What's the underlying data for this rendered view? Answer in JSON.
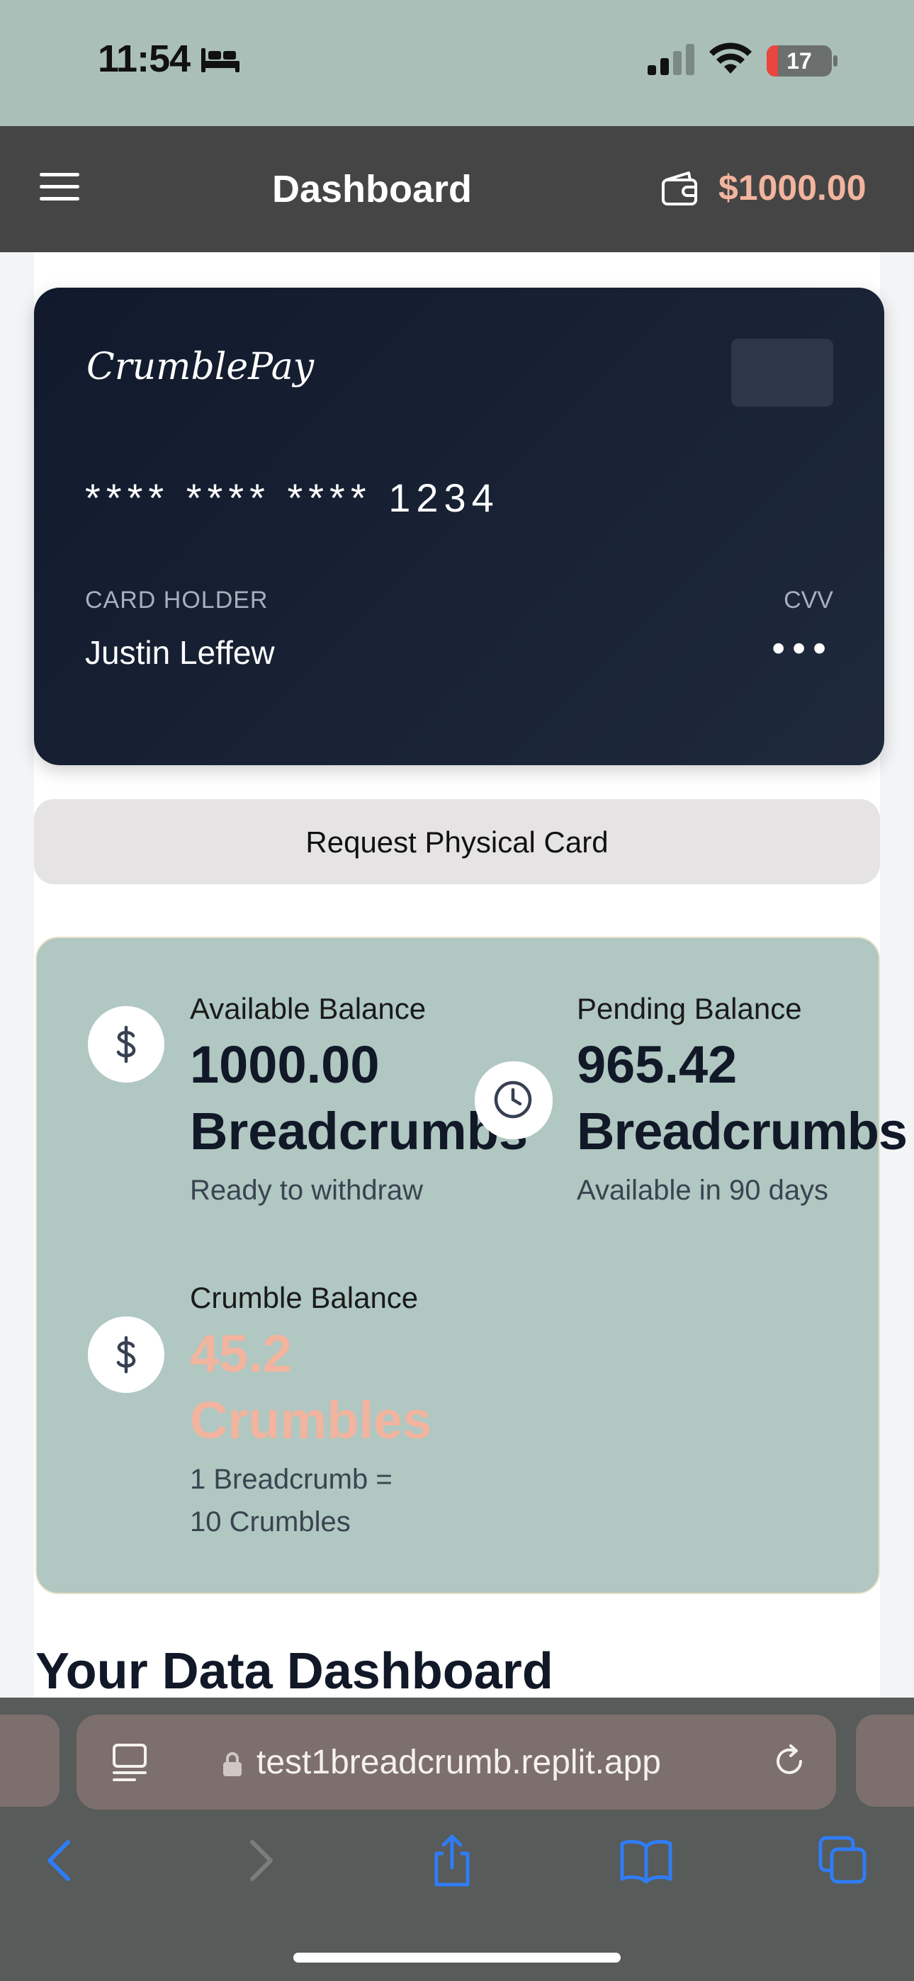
{
  "status_bar": {
    "time": "11:54",
    "battery": "17",
    "battery_level": 0.17
  },
  "header": {
    "title": "Dashboard",
    "wallet_amount": "$1000.00"
  },
  "card": {
    "brand": "CrumblePay",
    "number": "**** **** **** 1234",
    "holder_label": "CARD HOLDER",
    "holder_name": "Justin Leffew",
    "cvv_label": "CVV",
    "cvv_value": "•••"
  },
  "request_button": "Request Physical Card",
  "balances": {
    "available": {
      "label": "Available Balance",
      "amount": "1000.00",
      "unit": "Breadcrumbs",
      "note": "Ready to withdraw"
    },
    "pending": {
      "label": "Pending Balance",
      "amount": "965.42",
      "unit": "Breadcrumbs",
      "note": "Available in 90 days"
    },
    "crumble": {
      "label": "Crumble Balance",
      "amount": "45.2",
      "unit": "Crumbles",
      "note_line1": "1 Breadcrumb =",
      "note_line2": "10 Crumbles"
    }
  },
  "data_dashboard_heading": "Your Data Dashboard",
  "browser": {
    "url": "test1breadcrumb.replit.app"
  },
  "colors": {
    "accent": "#f2b49e",
    "card_bg": "#111a2c",
    "balances_bg": "#b0c7c2",
    "header_bg": "#454545",
    "status_bg": "#aabfb8",
    "ios_blue": "#2f7cf6"
  },
  "icons": [
    "bed-icon",
    "signal-icon",
    "wifi-icon",
    "menu-icon",
    "wallet-icon",
    "dollar-icon",
    "clock-icon",
    "reader-icon",
    "lock-icon",
    "reload-icon",
    "back-icon",
    "forward-icon",
    "share-icon",
    "bookmarks-icon",
    "tabs-icon"
  ]
}
